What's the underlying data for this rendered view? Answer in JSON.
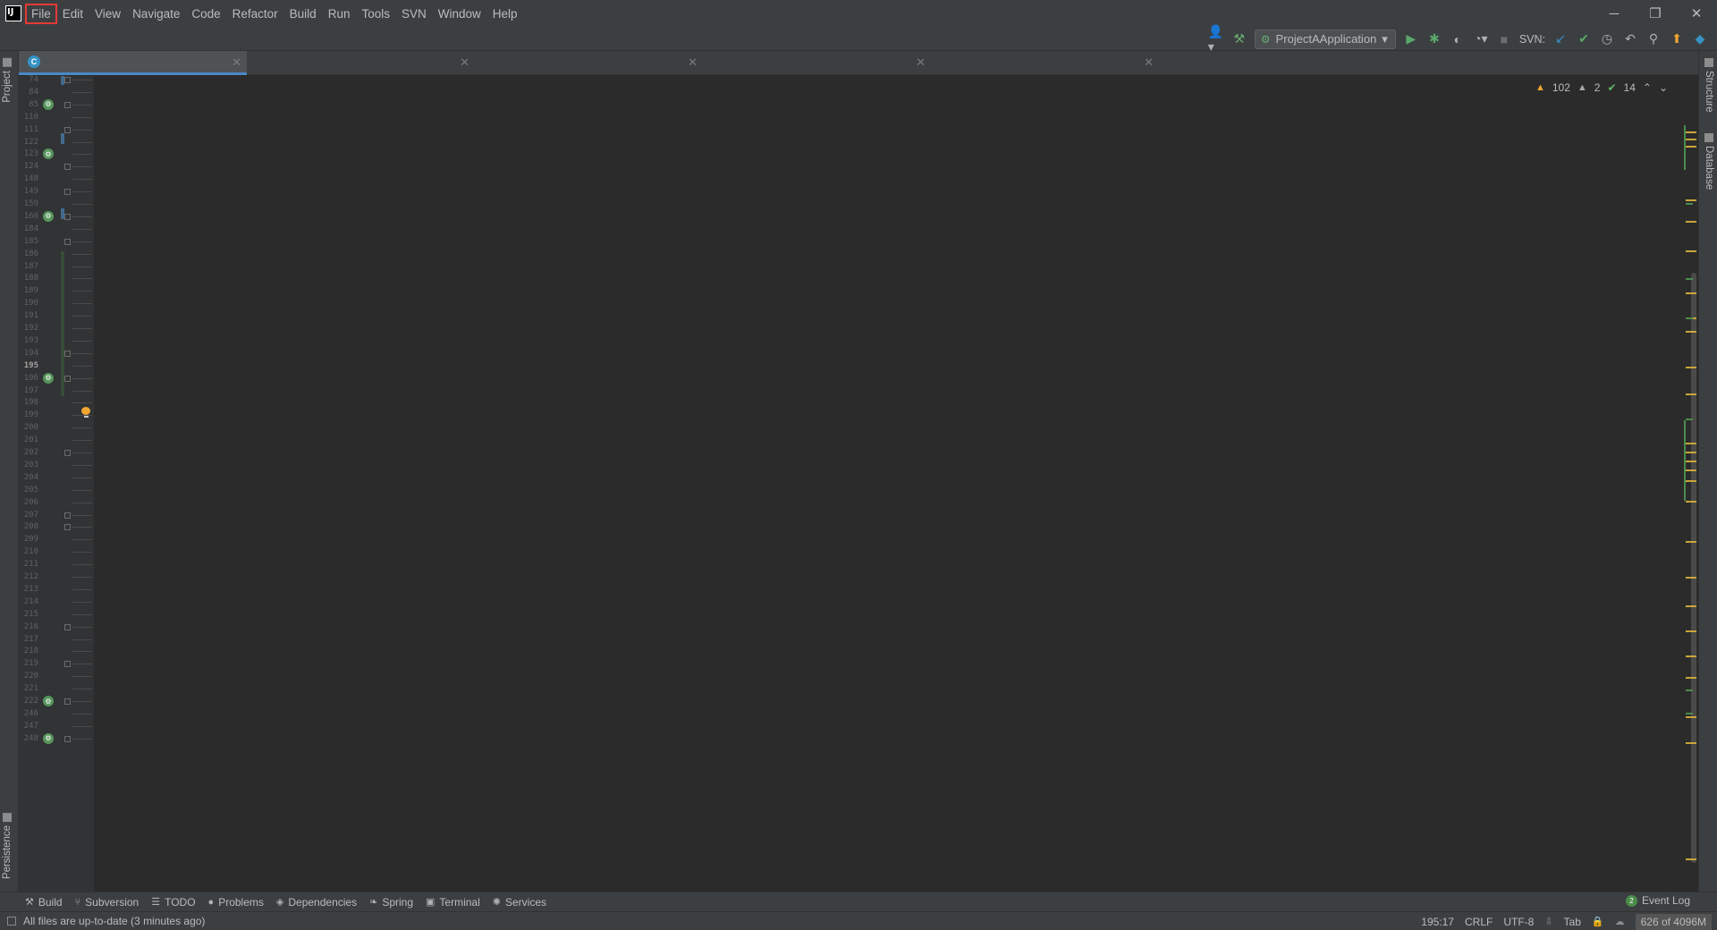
{
  "menubar": {
    "logo_text": "IJ",
    "items": [
      "File",
      "Edit",
      "View",
      "Navigate",
      "Code",
      "Refactor",
      "Build",
      "Run",
      "Tools",
      "SVN",
      "Window",
      "Help"
    ],
    "selected": "File"
  },
  "toolbar": {
    "run_config": "ProjectAApplication",
    "svn_label": "SVN:",
    "icons": [
      "user-icon",
      "hammer-icon",
      "run-icon",
      "debug-icon",
      "coverage-icon",
      "profile-icon",
      "stop-icon",
      "svn-update-icon",
      "svn-commit-icon",
      "history-icon",
      "revert-icon",
      "search-icon",
      "update-icon",
      "plugin-icon"
    ]
  },
  "left_strip": {
    "top_tab": "Project",
    "bottom_tab": "Persistence"
  },
  "right_strip": {
    "tabs": [
      "Structure",
      "Database"
    ]
  },
  "editor_tabs": [
    {
      "label": "",
      "active": true
    },
    {
      "label": "",
      "active": false
    },
    {
      "label": "",
      "active": false
    },
    {
      "label": "",
      "active": false
    },
    {
      "label": "",
      "active": false
    }
  ],
  "inspection": {
    "warnings": "102",
    "weak_warnings": "2",
    "ok": "14"
  },
  "gutter": {
    "lines": [
      {
        "n": "74",
        "icon": false,
        "fold": true
      },
      {
        "n": "84",
        "icon": false,
        "fold": false
      },
      {
        "n": "85",
        "icon": true,
        "fold": true
      },
      {
        "n": "110",
        "icon": false,
        "fold": false
      },
      {
        "n": "111",
        "icon": false,
        "fold": true
      },
      {
        "n": "122",
        "icon": false,
        "fold": false
      },
      {
        "n": "123",
        "icon": true,
        "fold": false
      },
      {
        "n": "124",
        "icon": false,
        "fold": true
      },
      {
        "n": "148",
        "icon": false,
        "fold": false
      },
      {
        "n": "149",
        "icon": false,
        "fold": true
      },
      {
        "n": "159",
        "icon": false,
        "fold": false
      },
      {
        "n": "160",
        "icon": true,
        "fold": true
      },
      {
        "n": "184",
        "icon": false,
        "fold": false
      },
      {
        "n": "185",
        "icon": false,
        "fold": true
      },
      {
        "n": "186",
        "icon": false,
        "fold": false
      },
      {
        "n": "187",
        "icon": false,
        "fold": false
      },
      {
        "n": "188",
        "icon": false,
        "fold": false
      },
      {
        "n": "189",
        "icon": false,
        "fold": false
      },
      {
        "n": "190",
        "icon": false,
        "fold": false
      },
      {
        "n": "191",
        "icon": false,
        "fold": false
      },
      {
        "n": "192",
        "icon": false,
        "fold": false
      },
      {
        "n": "193",
        "icon": false,
        "fold": false
      },
      {
        "n": "194",
        "icon": false,
        "fold": true
      },
      {
        "n": "195",
        "icon": false,
        "fold": false,
        "current": true
      },
      {
        "n": "196",
        "icon": true,
        "fold": true
      },
      {
        "n": "197",
        "icon": false,
        "fold": false
      },
      {
        "n": "198",
        "icon": false,
        "fold": false
      },
      {
        "n": "199",
        "icon": false,
        "fold": false
      },
      {
        "n": "200",
        "icon": false,
        "fold": false
      },
      {
        "n": "201",
        "icon": false,
        "fold": false
      },
      {
        "n": "202",
        "icon": false,
        "fold": true
      },
      {
        "n": "203",
        "icon": false,
        "fold": false
      },
      {
        "n": "204",
        "icon": false,
        "fold": false
      },
      {
        "n": "205",
        "icon": false,
        "fold": false
      },
      {
        "n": "206",
        "icon": false,
        "fold": false
      },
      {
        "n": "207",
        "icon": false,
        "fold": true
      },
      {
        "n": "208",
        "icon": false,
        "fold": true
      },
      {
        "n": "209",
        "icon": false,
        "fold": false
      },
      {
        "n": "210",
        "icon": false,
        "fold": false
      },
      {
        "n": "211",
        "icon": false,
        "fold": false
      },
      {
        "n": "212",
        "icon": false,
        "fold": false
      },
      {
        "n": "213",
        "icon": false,
        "fold": false
      },
      {
        "n": "214",
        "icon": false,
        "fold": false
      },
      {
        "n": "215",
        "icon": false,
        "fold": false
      },
      {
        "n": "216",
        "icon": false,
        "fold": true
      },
      {
        "n": "217",
        "icon": false,
        "fold": false
      },
      {
        "n": "218",
        "icon": false,
        "fold": false
      },
      {
        "n": "219",
        "icon": false,
        "fold": true
      },
      {
        "n": "220",
        "icon": false,
        "fold": false
      },
      {
        "n": "221",
        "icon": false,
        "fold": false
      },
      {
        "n": "222",
        "icon": true,
        "fold": true
      },
      {
        "n": "246",
        "icon": false,
        "fold": false
      },
      {
        "n": "247",
        "icon": false,
        "fold": false
      },
      {
        "n": "248",
        "icon": true,
        "fold": true
      }
    ]
  },
  "bottom_tools": [
    {
      "label": "Build",
      "icon": "hammer-icon"
    },
    {
      "label": "Subversion",
      "icon": "branch-icon"
    },
    {
      "label": "TODO",
      "icon": "list-icon"
    },
    {
      "label": "Problems",
      "icon": "info-icon"
    },
    {
      "label": "Dependencies",
      "icon": "layers-icon"
    },
    {
      "label": "Spring",
      "icon": "leaf-icon"
    },
    {
      "label": "Terminal",
      "icon": "terminal-icon"
    },
    {
      "label": "Services",
      "icon": "services-icon"
    }
  ],
  "event_log": {
    "label": "Event Log",
    "count": "2"
  },
  "status": {
    "message": "All files are up-to-date (3 minutes ago)",
    "position": "195:17",
    "line_sep": "CRLF",
    "encoding": "UTF-8",
    "indent": "Tab",
    "memory": "626 of 4096M"
  },
  "colors": {
    "background": "#2b2b2b",
    "chrome": "#3c3f41",
    "accent": "#4a88c7",
    "warning": "#f0a732",
    "ok": "#5fb85f"
  }
}
